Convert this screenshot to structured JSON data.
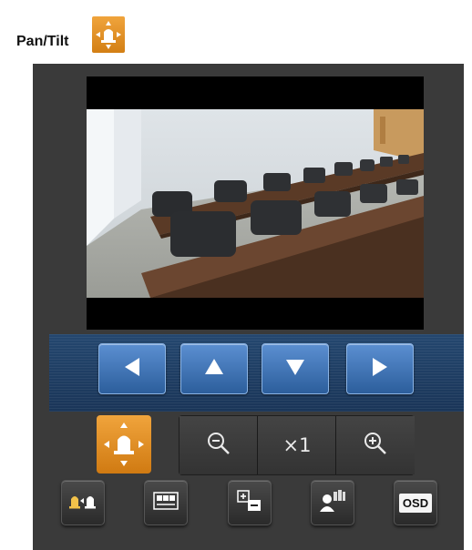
{
  "header": {
    "label": "Pan/Tilt",
    "icon": "pan-tilt-icon"
  },
  "direction_controls": {
    "left_icon": "arrow-left-icon",
    "up_icon": "arrow-up-icon",
    "down_icon": "arrow-down-icon",
    "right_icon": "arrow-right-icon"
  },
  "zoom": {
    "mode_icon": "pan-tilt-icon",
    "zoom_out_icon": "zoom-out-icon",
    "level": "×1",
    "zoom_in_icon": "zoom-in-icon"
  },
  "bottom_toolbar": {
    "buttons": [
      {
        "icon": "home-position-icon"
      },
      {
        "icon": "preset-icon"
      },
      {
        "icon": "brightness-adjust-icon"
      },
      {
        "icon": "auto-tracking-icon"
      },
      {
        "icon": "osd-icon",
        "label": "OSD"
      }
    ]
  },
  "colors": {
    "accent_orange": "#e8922a",
    "button_blue": "#3a72b8",
    "panel_bg": "#3a3a3a",
    "strip_blue": "#213f64"
  }
}
